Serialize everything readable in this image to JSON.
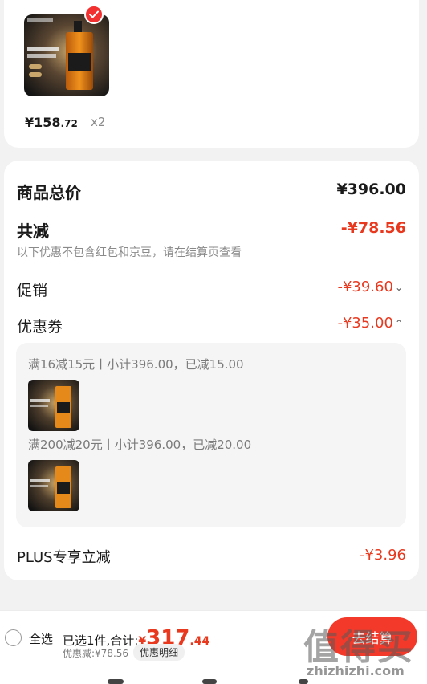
{
  "item": {
    "price_int": "¥158",
    "price_dec": ".72",
    "qty": "x2"
  },
  "summary": {
    "goods_total_label": "商品总价",
    "goods_total_value": "¥396.00",
    "reduce_label": "共减",
    "reduce_value": "-¥78.56",
    "note": "以下优惠不包含红包和京豆，请在结算页查看",
    "promo_label": "促销",
    "promo_value": "-¥39.60",
    "coupon_label": "优惠券",
    "coupon_value": "-¥35.00",
    "plus_label": "PLUS专享立减",
    "plus_value": "-¥3.96"
  },
  "coupons": [
    {
      "title": "满16减15元丨小计396.00，已减15.00"
    },
    {
      "title": "满200减20元丨小计396.00，已减20.00"
    }
  ],
  "bottom": {
    "select_all": "全选",
    "selected_text": "已选1件,合计:",
    "currency": "¥",
    "total_int": "317",
    "total_dec": ".44",
    "discount_text": "优惠减:¥78.56",
    "detail_chip": "优惠明细",
    "checkout": "去结算"
  },
  "watermark": {
    "glyphs": "值得买",
    "url": "zhizhizhi.com"
  },
  "colors": {
    "accent_red": "#e8391f",
    "checkout_red": "#f33a2a"
  }
}
